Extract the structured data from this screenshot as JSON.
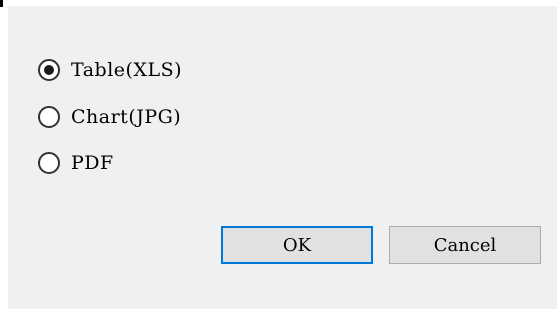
{
  "dialog": {
    "options": [
      {
        "label": "Table(XLS)",
        "selected": true
      },
      {
        "label": "Chart(JPG)",
        "selected": false
      },
      {
        "label": "PDF",
        "selected": false
      }
    ],
    "buttons": {
      "ok_label": "OK",
      "cancel_label": "Cancel"
    }
  },
  "colors": {
    "background": "#f0f0f0",
    "button_face": "#e1e1e1",
    "default_button_border": "#0078d7",
    "button_border": "#adadad"
  }
}
